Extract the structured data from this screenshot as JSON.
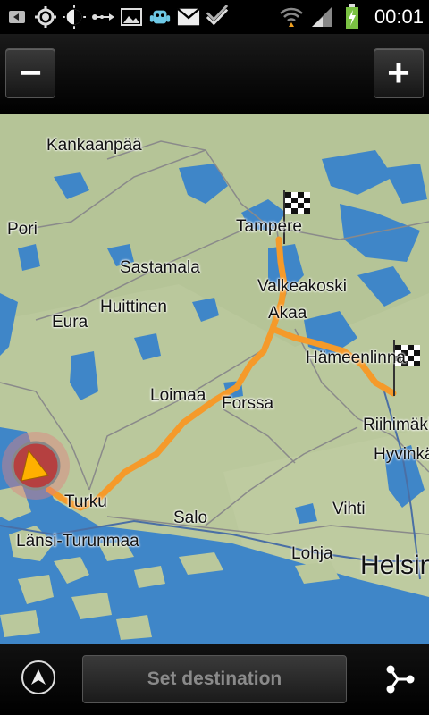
{
  "status_bar": {
    "time": "00:01",
    "icons": [
      "back-icon",
      "gps-icon",
      "brightness-icon",
      "usb-icon",
      "gallery-icon",
      "android-icon",
      "mail-icon",
      "check-icon",
      "wifi-icon",
      "signal-icon",
      "battery-charging-icon"
    ]
  },
  "zoom": {
    "out_label": "−",
    "in_label": "+"
  },
  "map": {
    "places": [
      {
        "name": "Kankaanpää"
      },
      {
        "name": "Pori"
      },
      {
        "name": "Tampere"
      },
      {
        "name": "Sastamala"
      },
      {
        "name": "Valkeakoski"
      },
      {
        "name": "Huittinen"
      },
      {
        "name": "Akaa"
      },
      {
        "name": "Eura"
      },
      {
        "name": "Hämeenlinna"
      },
      {
        "name": "Loimaa"
      },
      {
        "name": "Forssa"
      },
      {
        "name": "Riihimäki"
      },
      {
        "name": "Hyvinkää"
      },
      {
        "name": "Turku"
      },
      {
        "name": "Salo"
      },
      {
        "name": "Vihti"
      },
      {
        "name": "Länsi-Turunmaa"
      },
      {
        "name": "Lohja"
      },
      {
        "name": "Helsinki"
      }
    ],
    "route_color": "#f59a2a",
    "water_color": "#3f86c8",
    "land_color": "#b9c79a"
  },
  "bottom_bar": {
    "set_destination_label": "Set destination"
  }
}
